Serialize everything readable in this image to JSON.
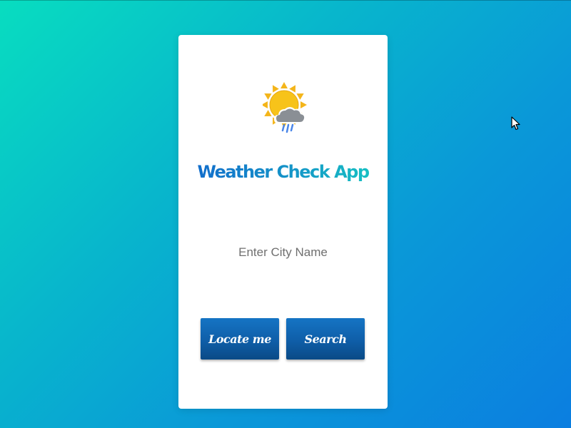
{
  "app": {
    "title": "Weather Check App",
    "logo_icon": "sun-rain-cloud-icon"
  },
  "search": {
    "placeholder": "Enter City Name",
    "value": ""
  },
  "buttons": {
    "locate_label": "Locate me",
    "search_label": "Search"
  },
  "colors": {
    "background_start": "#08ddc0",
    "background_end": "#0b7ee0",
    "card": "#ffffff",
    "title_start": "#1166cc",
    "title_end": "#16c9c2",
    "button": "#0f5ea8",
    "sun": "#f7c31a",
    "cloud": "#8a8f95",
    "rain": "#4a86e8"
  }
}
